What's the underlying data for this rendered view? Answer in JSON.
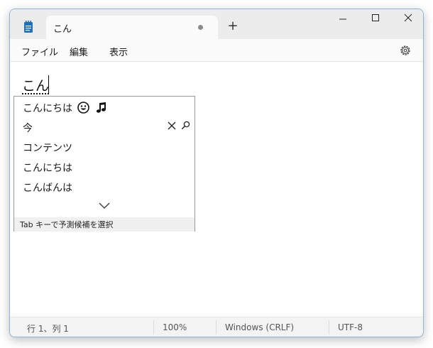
{
  "tab": {
    "title": "こん"
  },
  "window_controls": {
    "new_tab": "+"
  },
  "menu": {
    "file": "ファイル",
    "edit": "編集",
    "view": "表示"
  },
  "editor": {
    "typed_text": "こん"
  },
  "ime": {
    "candidates": [
      "こんにちは",
      "今",
      "コンテンツ",
      "こんにちは",
      "こんばんは"
    ],
    "hint": "Tab キーで予測候補を選択"
  },
  "status": {
    "position": "行 1、列 1",
    "zoom": "100%",
    "line_ending": "Windows (CRLF)",
    "encoding": "UTF-8"
  },
  "colors": {
    "window_border": "#8fb3d9",
    "app_icon": "#1f6fbf"
  },
  "icons": [
    "notepad-icon",
    "close-icon",
    "minimize-icon",
    "maximize-icon",
    "gear-icon",
    "smiley-emoji-icon",
    "music-note-emoji-icon",
    "search-icon",
    "chevron-down-icon"
  ]
}
